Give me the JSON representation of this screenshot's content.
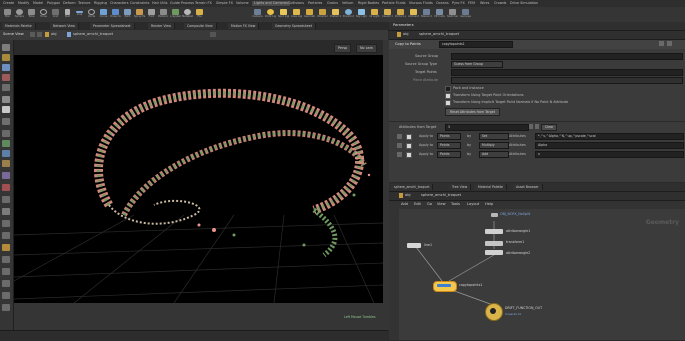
{
  "shelf": {
    "tabs": [
      "Create",
      "Modify",
      "Model",
      "Polygon",
      "Deform",
      "Texture",
      "Rigging",
      "Characters",
      "Constraints",
      "Hair Utils",
      "Guide Process",
      "Terrain FX",
      "Simple FX",
      "Volume",
      "Lights and Cameras",
      "Collisions",
      "Particles",
      "Grains",
      "Vellum",
      "Rigid Bodies",
      "Particle Fluids",
      "Viscous Fluids",
      "Oceans",
      "Pyro FX",
      "FEM",
      "Wires",
      "Crowds",
      "Drive Simulation"
    ],
    "tools": [
      "Box",
      "Sphere",
      "Tube",
      "Torus",
      "Grid",
      "Null",
      "Line",
      "Circle",
      "Curve",
      "Draw Curve",
      "Path",
      "Spray Paint",
      "Font",
      "Platonic Solids",
      "L-System",
      "Metaball",
      "File"
    ],
    "tools_right": [
      "Camera",
      "Point Light",
      "Spot Light",
      "Area Light",
      "Geometry Light",
      "Volume Light",
      "Distant Light",
      "Environment Light",
      "Sky Light",
      "GI Light",
      "Caustic Light",
      "Portal Light",
      "Ambient Light",
      "Stereo Camera",
      "VR Camera",
      "Switcher",
      "Gamepad Camera"
    ]
  },
  "desk_tabs": [
    "Materials Palette",
    "Network View",
    "Parameter Spreadsheet",
    "Render View",
    "Composite View",
    "Motion FX View",
    "Geometry Spreadsheet"
  ],
  "viewport": {
    "tab": "Scene View",
    "path": "obj",
    "node": "sphere_amchi_troquet",
    "persp": "Persp",
    "cam": "No cam",
    "status": "Left Mouse Tumbles"
  },
  "params": {
    "tab": "Parameters",
    "path": "obj",
    "node": "sphere_amchi_troquet",
    "node_type": "Copy to Points",
    "node_name": "copytopoints1",
    "rows": [
      {
        "label": "Source Group",
        "value": ""
      },
      {
        "label": "Source Group Type",
        "value": "Guess from Group"
      },
      {
        "label": "Target Points",
        "value": ""
      },
      {
        "label": "Piece Attribute",
        "value": ""
      }
    ],
    "checks": [
      "Pack and Instance",
      "Transform Using Target Point Orientations",
      "Transform Using Implicit Target Point Normals if No Point N Attribute"
    ],
    "reset_button": "Reset Attributes from Target",
    "attr_label": "Attributes from Target",
    "attr_count": "3",
    "clear_button": "Clear",
    "attr_rows": [
      {
        "apply": "Apply to",
        "src": "Points",
        "by": "Set",
        "attrs": "Attributes",
        "value": "*,^v,^Alpha,^N,^up,^pscale,^scal"
      },
      {
        "apply": "Apply to",
        "src": "Points",
        "by": "Multiply",
        "attrs": "Attributes",
        "value": "Alpha"
      },
      {
        "apply": "Apply to",
        "src": "Points",
        "by": "Add",
        "attrs": "Attributes",
        "value": "v"
      }
    ]
  },
  "network": {
    "tabs": [
      "sphere_amchi_troquet",
      "Tree View",
      "Material Palette",
      "Asset Browser"
    ],
    "path": "obj",
    "node": "sphere_amchi_troquet",
    "menu": [
      "Add",
      "Edit",
      "Go",
      "View",
      "Tools",
      "Layout",
      "Help"
    ],
    "context_label": "Geometry",
    "nodes": [
      {
        "name": "OBJ_NOFX_NoSplit",
        "sub": ""
      },
      {
        "name": "attribwrangle1",
        "sub": ""
      },
      {
        "name": "transform1",
        "sub": ""
      },
      {
        "name": "attribwrangle2",
        "sub": ""
      },
      {
        "name": "copytopoints1",
        "sub": ""
      },
      {
        "name": "line1",
        "sub": ""
      },
      {
        "name": "DRIFT_FUNCTION_OUT",
        "sub": "Unpacks 1k"
      }
    ]
  },
  "colors": {
    "accent": "#f5a623",
    "node_selected": "#f2c94c",
    "node_wrangle": "#c9c9c9",
    "viewport_bg": "#000000",
    "particle_pink": "#e8978a",
    "particle_green": "#6f9a62"
  }
}
